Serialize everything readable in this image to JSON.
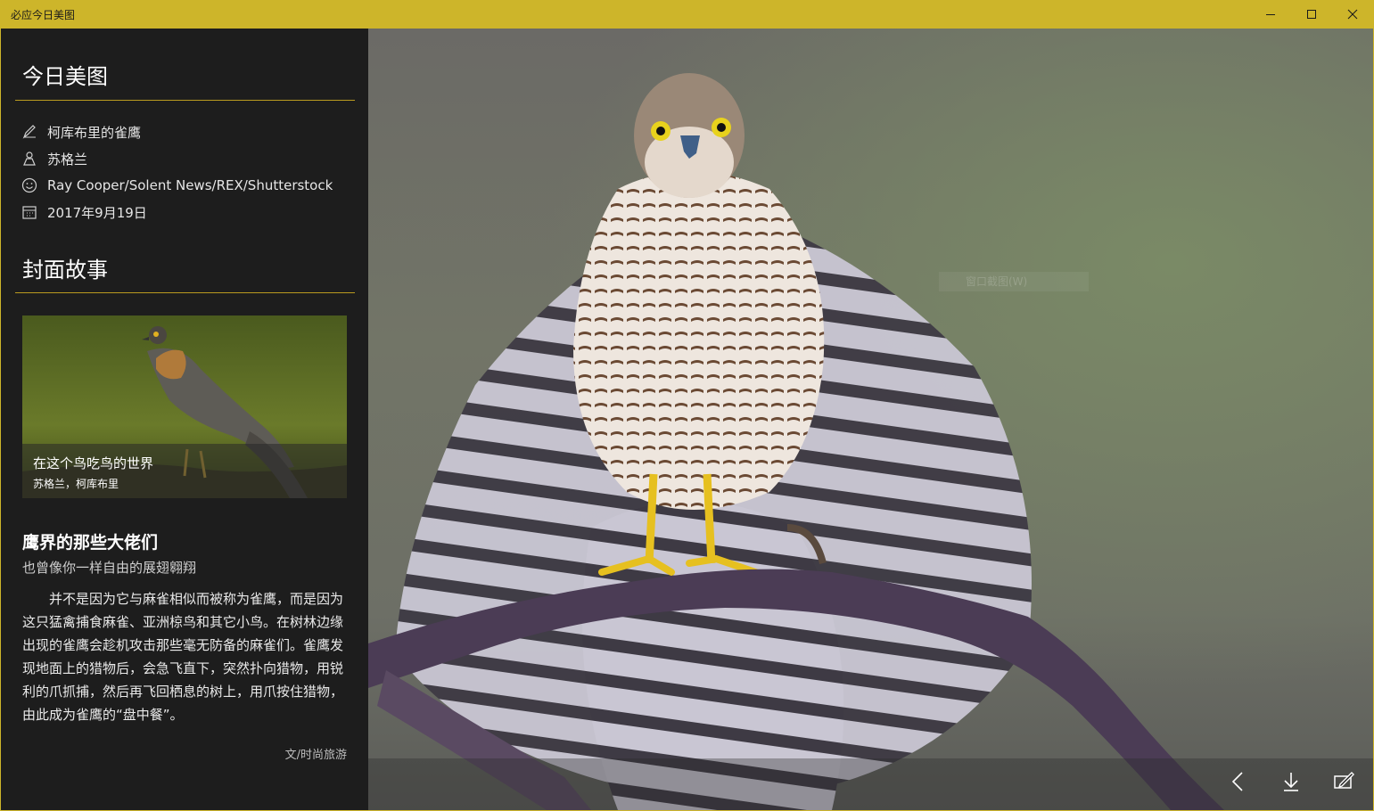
{
  "window": {
    "title": "必应今日美图",
    "accent_color": "#cdb52a",
    "controls": [
      "minimize-icon",
      "maximize-icon",
      "close-icon"
    ]
  },
  "sidebar": {
    "heading_today": "今日美图",
    "info": [
      {
        "icon": "pen-icon",
        "text": "柯库布里的雀鹰"
      },
      {
        "icon": "location-person-icon",
        "text": "苏格兰"
      },
      {
        "icon": "smiley-icon",
        "text": "Ray Cooper/Solent News/REX/Shutterstock"
      },
      {
        "icon": "calendar-icon",
        "text": "2017年9月19日"
      }
    ],
    "heading_cover": "封面故事",
    "story_card": {
      "title": "在这个鸟吃鸟的世界",
      "location": "苏格兰，柯库布里"
    },
    "article": {
      "title": "鹰界的那些大佬们",
      "subtitle": "也曾像你一样自由的展翅翱翔",
      "body": "并不是因为它与麻雀相似而被称为雀鹰，而是因为这只猛禽捕食麻雀、亚洲椋鸟和其它小鸟。在树林边缘出现的雀鹰会趁机攻击那些毫无防备的麻雀们。雀鹰发现地面上的猎物后，会急飞直下，突然扑向猎物，用锐利的爪抓捕，然后再飞回栖息的树上，用爪按住猎物，由此成为雀鹰的“盘中餐”。",
      "source": "文/时尚旅游"
    }
  },
  "main": {
    "ghost_menu_text": "窗口截图(W)",
    "appbar": [
      "back-icon",
      "download-icon",
      "set-wallpaper-icon"
    ]
  }
}
